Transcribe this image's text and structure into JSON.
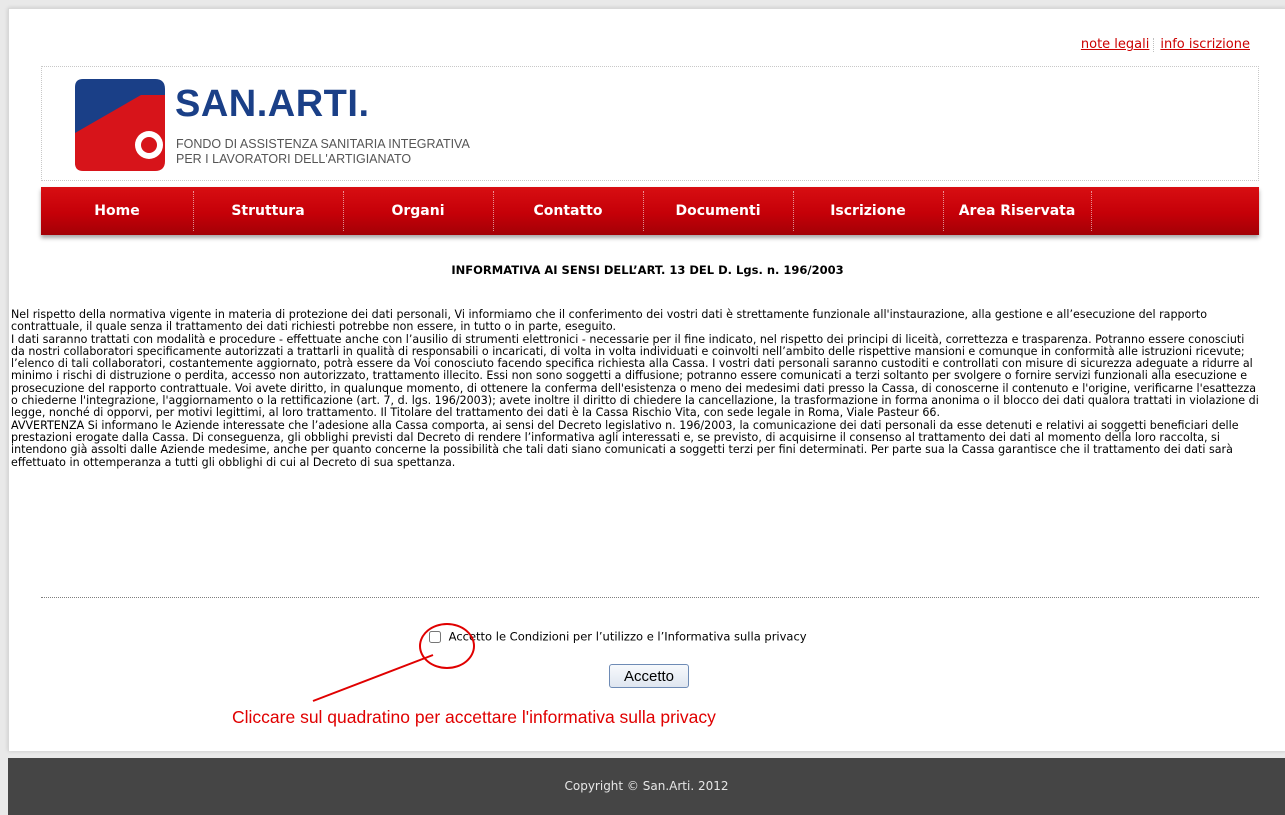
{
  "top_links": {
    "legal": "note legali",
    "enrollment": "info iscrizione"
  },
  "brand": {
    "name": "SAN.ARTI.",
    "subtitle_line1": "FONDO DI ASSISTENZA SANITARIA INTEGRATIVA",
    "subtitle_line2": "PER I LAVORATORI DELL'ARTIGIANATO",
    "logo_colors": {
      "blue": "#1a3f87",
      "red": "#d7141a"
    }
  },
  "nav": {
    "items": [
      {
        "label": "Home"
      },
      {
        "label": "Struttura"
      },
      {
        "label": "Organi"
      },
      {
        "label": "Contatto"
      },
      {
        "label": "Documenti"
      },
      {
        "label": "Iscrizione"
      },
      {
        "label": "Area Riservata"
      }
    ],
    "color": "#c50008"
  },
  "notice": {
    "title": "INFORMATIVA AI SENSI DELL’ART. 13 DEL D. Lgs. n. 196/2003",
    "paragraph1": "Nel rispetto della normativa vigente in materia di protezione dei dati personali, Vi informiamo che il conferimento dei vostri dati è strettamente funzionale all'instaurazione, alla gestione e all’esecuzione del rapporto contrattuale, il quale senza il trattamento dei dati richiesti potrebbe non essere, in tutto o in parte, eseguito.",
    "paragraph2": "I dati saranno trattati con modalità e procedure - effettuate anche con l’ausilio di strumenti elettronici - necessarie per il fine indicato, nel rispetto dei principi di liceità, correttezza e trasparenza. Potranno essere conosciuti da nostri collaboratori specificamente autorizzati a trattarli in qualità di responsabili o incaricati, di volta in volta individuati e coinvolti nell’ambito delle rispettive mansioni e comunque in conformità alle istruzioni ricevute; l’elenco di tali collaboratori, costantemente aggiornato, potrà essere da Voi conosciuto facendo specifica richiesta alla Cassa. I vostri dati personali saranno custoditi e controllati con misure di sicurezza adeguate a ridurre al minimo i rischi di distruzione o perdita, accesso non autorizzato, trattamento illecito. Essi non sono soggetti a diffusione; potranno essere comunicati a terzi soltanto per svolgere o fornire servizi funzionali alla esecuzione e prosecuzione del rapporto contrattuale. Voi avete diritto, in qualunque momento, di ottenere la conferma dell'esistenza o meno dei medesimi dati presso la Cassa, di conoscerne il contenuto e l'origine, verificarne l'esattezza o chiederne l'integrazione, l'aggiornamento o la rettificazione (art. 7, d. lgs. 196/2003); avete inoltre il diritto di chiedere la cancellazione, la trasformazione in forma anonima o il blocco dei dati qualora trattati in violazione di legge, nonché di opporvi, per motivi legittimi, al loro trattamento. Il Titolare del trattamento dei dati è la Cassa Rischio Vita, con sede legale in Roma, Viale Pasteur 66.",
    "paragraph3": "AVVERTENZA Si informano le Aziende interessate che l’adesione alla Cassa comporta, ai sensi del Decreto legislativo n. 196/2003, la comunicazione dei dati personali da esse detenuti e relativi ai soggetti beneficiari delle prestazioni erogate dalla Cassa. Di conseguenza, gli obblighi previsti dal Decreto di rendere l’informativa agli interessati e, se previsto, di acquisirne il consenso al trattamento dei dati al momento della loro raccolta, si intendono già assolti dalle Aziende medesime, anche per quanto concerne la possibilità che tali dati siano comunicati a soggetti terzi per fini determinati. Per parte sua la Cassa garantisce che il trattamento dei dati sarà effettuato in ottemperanza a tutti gli obblighi di cui al Decreto di sua spettanza."
  },
  "consent": {
    "checkbox_label": "Accetto le Condizioni per l’utilizzo e l’Informativa sulla privacy",
    "checked": false,
    "button_label": "Accetto"
  },
  "annotation": {
    "text": "Cliccare sul quadratino per accettare l'informativa sulla privacy",
    "color": "#e00000"
  },
  "footer": {
    "copyright": "Copyright © San.Arti. 2012"
  }
}
